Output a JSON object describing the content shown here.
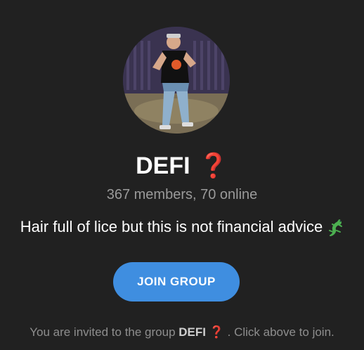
{
  "group": {
    "name": "DEFI",
    "name_emoji": "❓",
    "members_line": "367 members, 70 online",
    "description": "Hair full of lice but this is not financial advice",
    "description_emoji": "lizard-icon"
  },
  "join": {
    "button_label": "JOIN GROUP"
  },
  "footer": {
    "prefix": "You are invited to the group ",
    "group_name": "DEFI",
    "emoji": "❓",
    "suffix": ". Click above to join."
  },
  "colors": {
    "background": "#212121",
    "button": "#3f8ee0",
    "question_mark": "#e53935",
    "muted_text": "#9a9a9a"
  }
}
